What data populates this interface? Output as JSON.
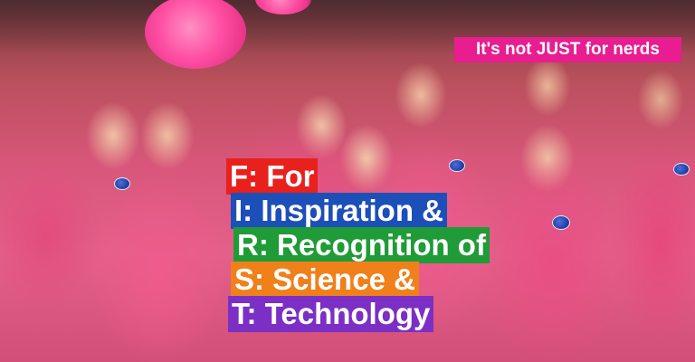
{
  "tagline": "It's not JUST for nerds",
  "acronym": [
    {
      "text": "F: For",
      "color": "#e8211d"
    },
    {
      "text": "I: Inspiration &",
      "color": "#1d4fb8"
    },
    {
      "text": "R: Recognition of",
      "color": "#1f9b37"
    },
    {
      "text": "S: Science &",
      "color": "#f0801a"
    },
    {
      "text": "T: Technology",
      "color": "#7b2fc5"
    }
  ],
  "colors": {
    "tagline_background": "#e81d8f",
    "crowd_pink": "#e4608a",
    "pom_pom_pink": "#ff4fa3",
    "text": "#ffffff"
  },
  "icons": [
    "pink-pom-pom-icon",
    "nasa-logo-icon"
  ]
}
